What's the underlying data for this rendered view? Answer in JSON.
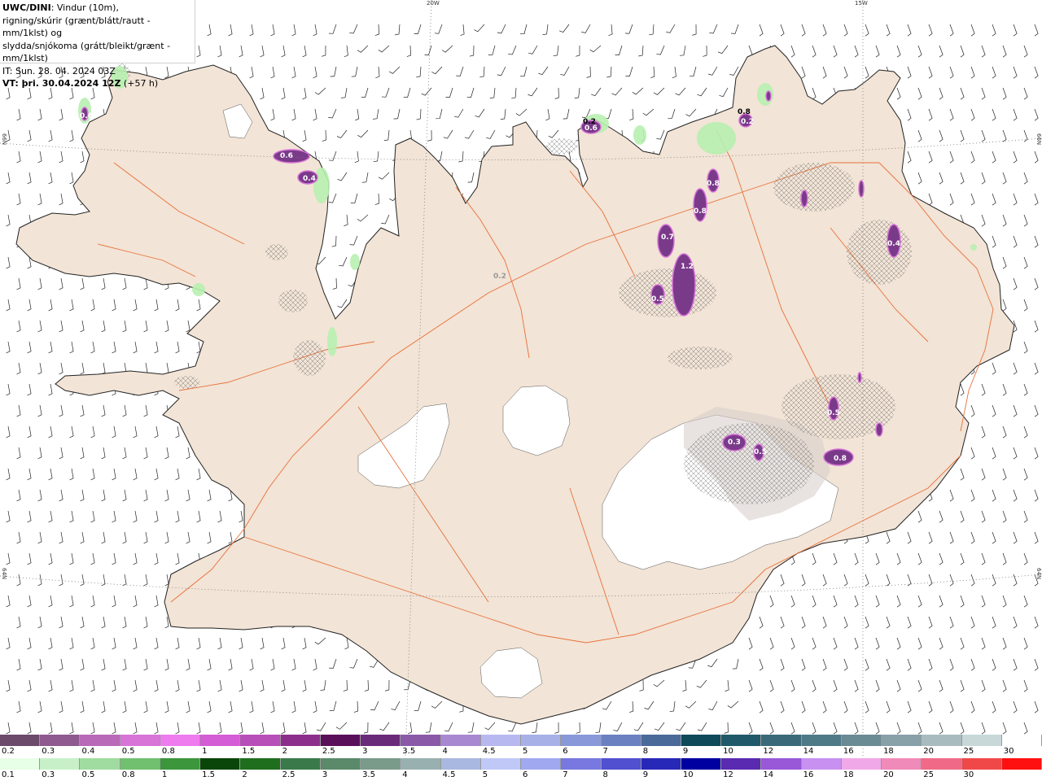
{
  "legend_text": {
    "line1_bold": "UWC/DINI",
    "line1_rest": ": Vindur (10m),",
    "line2": "rigning/skúrir (grænt/blátt/rautt - mm/1klst) og",
    "line3": "slydda/snjókoma (grátt/bleikt/grænt - mm/1klst)",
    "line4": "IT: Sun. 28. 04. 2024 03Z",
    "line5_bold": "VT: þri. 30.04.2024 12Z",
    "line5_rest": " (+57 h)"
  },
  "graticule": {
    "top_left": "20W",
    "top_right": "15W",
    "left_upper": "66N",
    "left_lower": "64N",
    "right_upper": "66N",
    "right_lower": "64N"
  },
  "snow_scale": {
    "labels": [
      "0.2",
      "0.3",
      "0.4",
      "0.5",
      "0.8",
      "1",
      "1.5",
      "2",
      "2.5",
      "3",
      "3.5",
      "4",
      "4.5",
      "5",
      "6",
      "7",
      "8",
      "9",
      "10",
      "12",
      "14",
      "16",
      "18",
      "20",
      "25",
      "30"
    ],
    "colors": [
      "#6b4a6b",
      "#8f5a8f",
      "#b86ab8",
      "#d873d8",
      "#ef7cef",
      "#d45cd4",
      "#b84eb8",
      "#8c2f8c",
      "#5a0f5a",
      "#6a2a7a",
      "#8a5aa8",
      "#a888d0",
      "#b8b8f0",
      "#a8b0e8",
      "#8898d8",
      "#6a80c0",
      "#4a6a9a",
      "#0e4a5a",
      "#205a6a",
      "#3a6a7a",
      "#4e7a88",
      "#6a8a94",
      "#88a0a8",
      "#a8bcc0",
      "#c8d8d8",
      "#ffffff"
    ]
  },
  "rain_scale": {
    "labels": [
      "0.1",
      "0.3",
      "0.5",
      "0.8",
      "1",
      "1.5",
      "2",
      "2.5",
      "3",
      "3.5",
      "4",
      "4.5",
      "5",
      "6",
      "7",
      "8",
      "9",
      "10",
      "12",
      "14",
      "16",
      "18",
      "20",
      "25",
      "30"
    ],
    "colors": [
      "#e6ffe6",
      "#c8f0c8",
      "#a0dca0",
      "#70c070",
      "#3c963c",
      "#0a460a",
      "#1e6e1e",
      "#3a7a4a",
      "#5a8a6a",
      "#7a9a8a",
      "#98b0b0",
      "#a8b8e0",
      "#c0c8f8",
      "#a0a8f0",
      "#7878e0",
      "#5050d0",
      "#2828b8",
      "#0000a0",
      "#5a2ab0",
      "#9858d8",
      "#c890f0",
      "#f0a8e8",
      "#f08ab8",
      "#f06a88",
      "#f04848",
      "#ff1010"
    ]
  },
  "precip_labels": [
    "0.6",
    "0.4",
    "0.6",
    "0.6",
    "0.8",
    "0.8",
    "0.2",
    "0.8",
    "0.7",
    "1.2",
    "0.5",
    "0.4",
    "0.2",
    "0.3",
    "0.5",
    "0.5",
    "0.8",
    "0.2"
  ]
}
